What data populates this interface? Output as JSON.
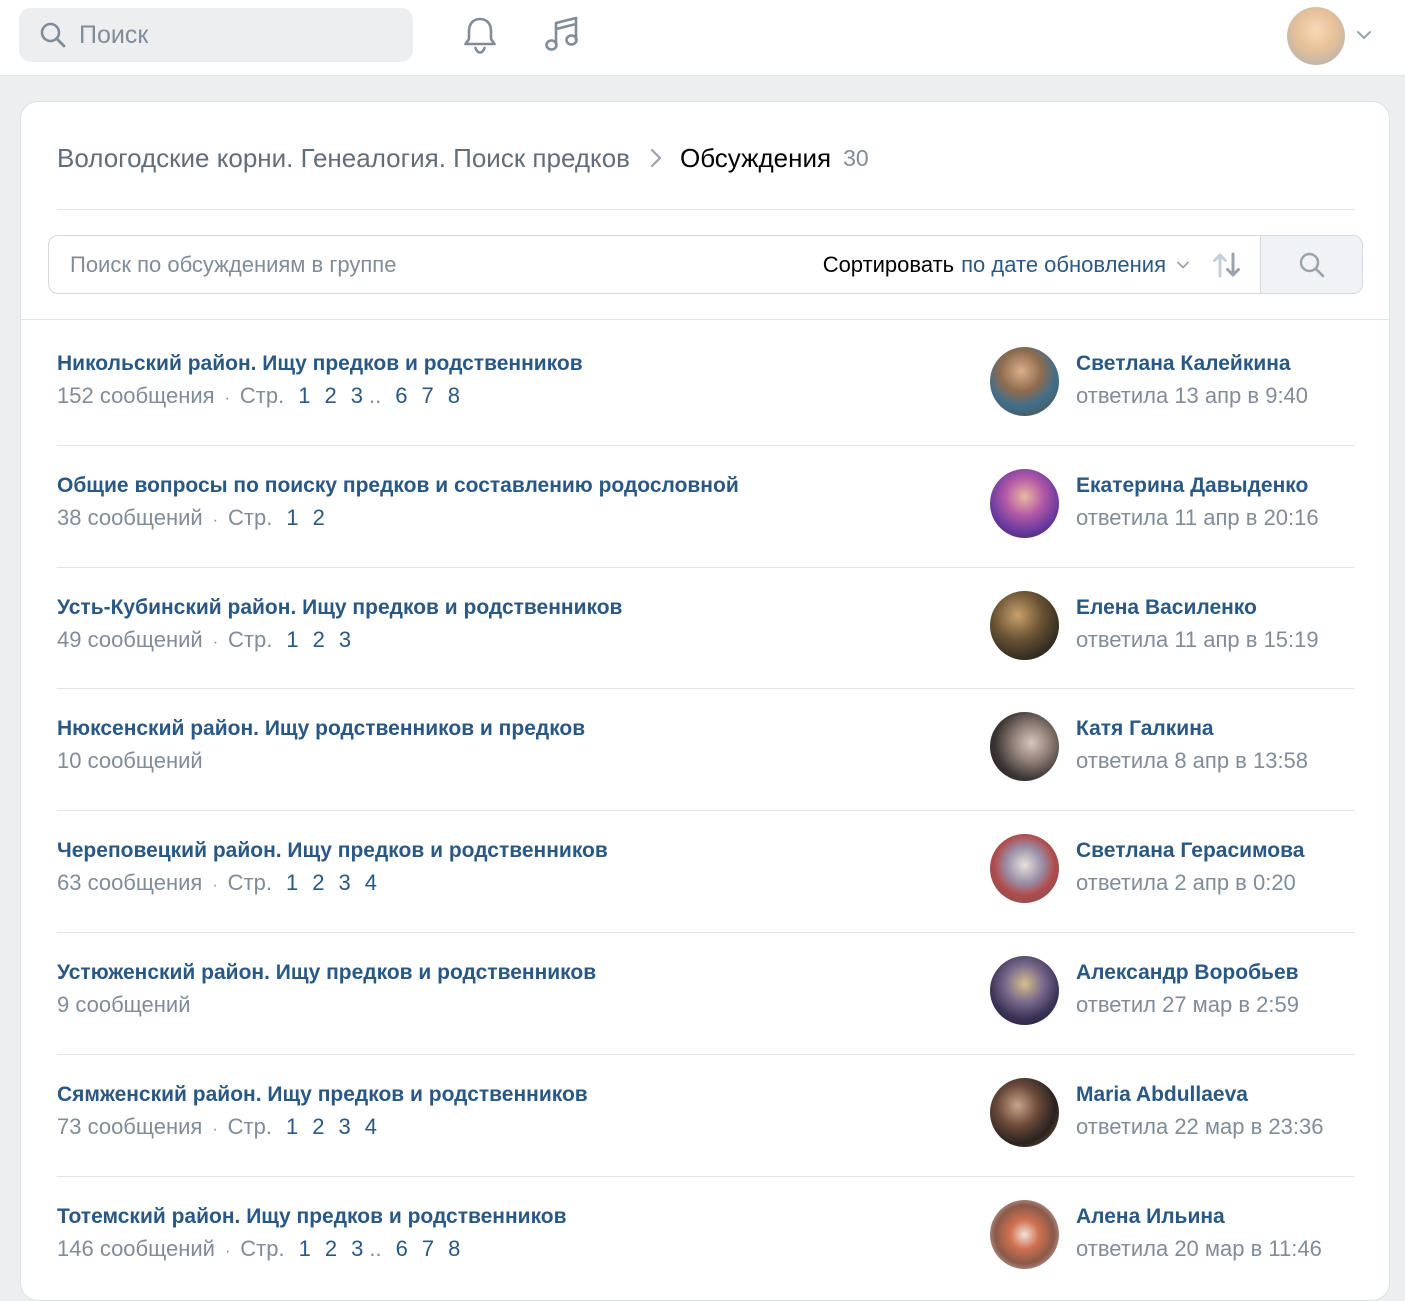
{
  "header": {
    "search_placeholder": "Поиск",
    "icons": [
      "search-icon",
      "bell-icon",
      "music-icon",
      "chevron-down-icon"
    ]
  },
  "breadcrumb": {
    "group": "Вологодские корни. Генеалогия. Поиск предков",
    "current": "Обсуждения",
    "count": "30"
  },
  "filter": {
    "placeholder": "Поиск по обсуждениям в группе",
    "sort_label": "Сортировать",
    "sort_value": "по дате обновления"
  },
  "colors": {
    "link": "#2a5885",
    "muted": "#818c99",
    "background": "#edeef0"
  },
  "topics": [
    {
      "title": "Никольский район. Ищу предков и родственников",
      "count": "152 сообщения",
      "pages_label": "Стр.",
      "pages": [
        "1",
        "2",
        "3",
        "..",
        "6",
        "7",
        "8"
      ],
      "author": "Светлана Калейкина",
      "replied": "ответила 13 апр в 9:40"
    },
    {
      "title": "Общие вопросы по поиску предков и составлению родословной",
      "count": "38 сообщений",
      "pages_label": "Стр.",
      "pages": [
        "1",
        "2"
      ],
      "author": "Екатерина Давыденко",
      "replied": "ответила 11 апр в 20:16"
    },
    {
      "title": "Усть-Кубинский район. Ищу предков и родственников",
      "count": "49 сообщений",
      "pages_label": "Стр.",
      "pages": [
        "1",
        "2",
        "3"
      ],
      "author": "Елена Василенко",
      "replied": "ответила 11 апр в 15:19"
    },
    {
      "title": "Нюксенский район. Ищу родственников и предков",
      "count": "10 сообщений",
      "pages_label": "",
      "pages": [],
      "author": "Катя Галкина",
      "replied": "ответила 8 апр в 13:58"
    },
    {
      "title": "Череповецкий район. Ищу предков и родственников",
      "count": "63 сообщения",
      "pages_label": "Стр.",
      "pages": [
        "1",
        "2",
        "3",
        "4"
      ],
      "author": "Светлана Герасимова",
      "replied": "ответила 2 апр в 0:20"
    },
    {
      "title": "Устюженский район. Ищу предков и родственников",
      "count": "9 сообщений",
      "pages_label": "",
      "pages": [],
      "author": "Александр Воробьев",
      "replied": "ответил 27 мар в 2:59"
    },
    {
      "title": "Сямженский район. Ищу предков и родственников",
      "count": "73 сообщения",
      "pages_label": "Стр.",
      "pages": [
        "1",
        "2",
        "3",
        "4"
      ],
      "author": "Maria Abdullaeva",
      "replied": "ответила 22 мар в 23:36"
    },
    {
      "title": "Тотемский район. Ищу предков и родственников",
      "count": "146 сообщений",
      "pages_label": "Стр.",
      "pages": [
        "1",
        "2",
        "3",
        "..",
        "6",
        "7",
        "8"
      ],
      "author": "Алена Ильина",
      "replied": "ответила 20 мар в 11:46"
    }
  ]
}
